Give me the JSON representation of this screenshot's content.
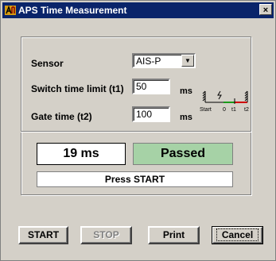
{
  "window": {
    "title": "APS Time Measurement",
    "close_label": "×",
    "app_icon": "aps-logo-icon"
  },
  "form": {
    "sensor": {
      "label": "Sensor",
      "value": "AIS-P",
      "dropdown_icon": "chevron-down-icon"
    },
    "switch_limit": {
      "label": "Switch time limit (t1)",
      "value": "50",
      "unit": "ms"
    },
    "gate_time": {
      "label": "Gate time (t2)",
      "value": "100",
      "unit": "ms"
    }
  },
  "diagram": {
    "labels": [
      "Start",
      "0",
      "t1",
      "t2"
    ]
  },
  "result": {
    "time": "19 ms",
    "status": "Passed",
    "message": "Press START"
  },
  "buttons": {
    "start": "START",
    "stop": "STOP",
    "print": "Print",
    "cancel": "Cancel"
  },
  "colors": {
    "titlebar": "#0a246a",
    "passed_bg": "#a6d2a6",
    "dialog_bg": "#d4d0c8"
  }
}
